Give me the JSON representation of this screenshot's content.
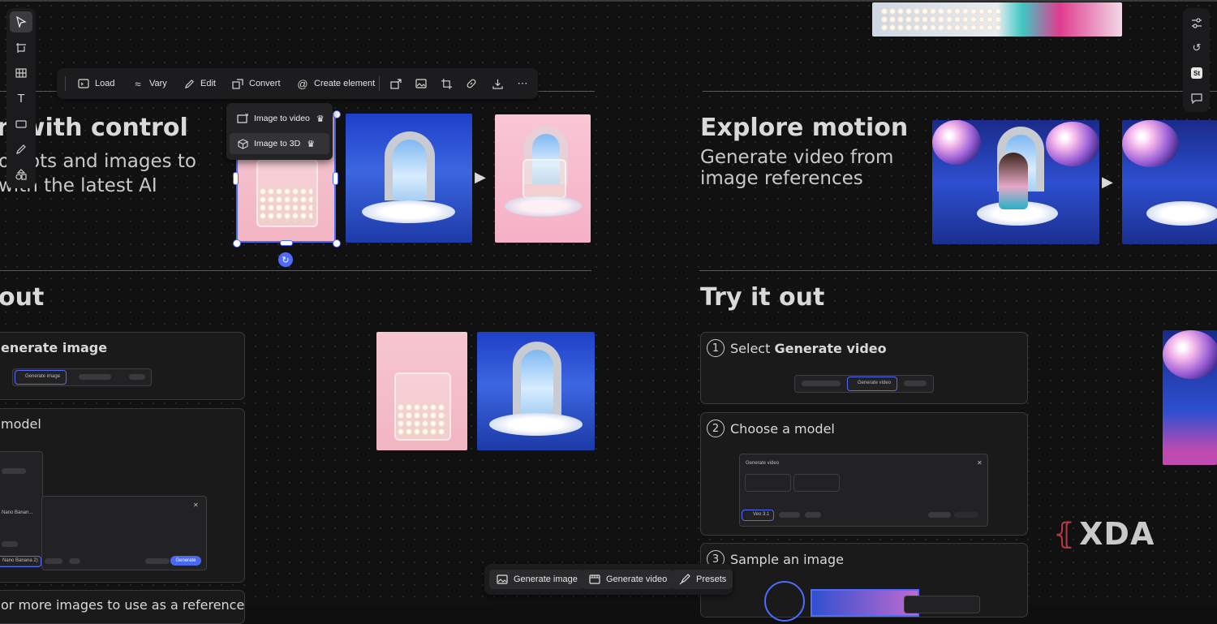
{
  "left_tools": [
    "select-icon",
    "frame-icon",
    "table-icon",
    "text-icon",
    "shape-icon",
    "pen-icon",
    "shapes-library-icon"
  ],
  "context_toolbar": {
    "load": "Load",
    "vary": "Vary",
    "edit": "Edit",
    "convert": "Convert",
    "create_element": "Create element"
  },
  "convert_menu": {
    "image_to_video": "Image to video",
    "image_to_3d": "Image to 3D"
  },
  "sections": {
    "left_heading": "n with control",
    "left_sub_1": "ompts and images to",
    "left_sub_2": "with the latest AI",
    "left_try": "out",
    "right_heading": "Explore motion",
    "right_sub_1": "Generate video from",
    "right_sub_2": "image references",
    "right_try": "Try it out"
  },
  "left_cards": {
    "step1": "enerate image",
    "step1_button": "Generate image",
    "step2": "model",
    "step2_model": "Nano Banana 2)",
    "step2_model_list": "Nano Banan...",
    "step2_generate": "Generate",
    "step3_partial": "or more images to use as a reference"
  },
  "right_cards": {
    "step1_num": "1",
    "step1_pre": "Select ",
    "step1_bold": "Generate video",
    "step1_button": "Generate video",
    "step2_num": "2",
    "step2": "Choose a model",
    "step2_panel_title": "Generate video",
    "step2_model": "Veo 3.1",
    "step3_num": "3",
    "step3": "Sample an image"
  },
  "right_tools": [
    "adjustments-icon",
    "history-icon",
    "stock-icon",
    "comment-icon"
  ],
  "stock_badge": "St",
  "bottom_bar": {
    "generate_image": "Generate image",
    "generate_video": "Generate video",
    "presets": "Presets"
  },
  "watermark": "XDA",
  "colors": {
    "accent": "#4f6bff",
    "background": "#111112",
    "panel": "#1c1c1e"
  }
}
